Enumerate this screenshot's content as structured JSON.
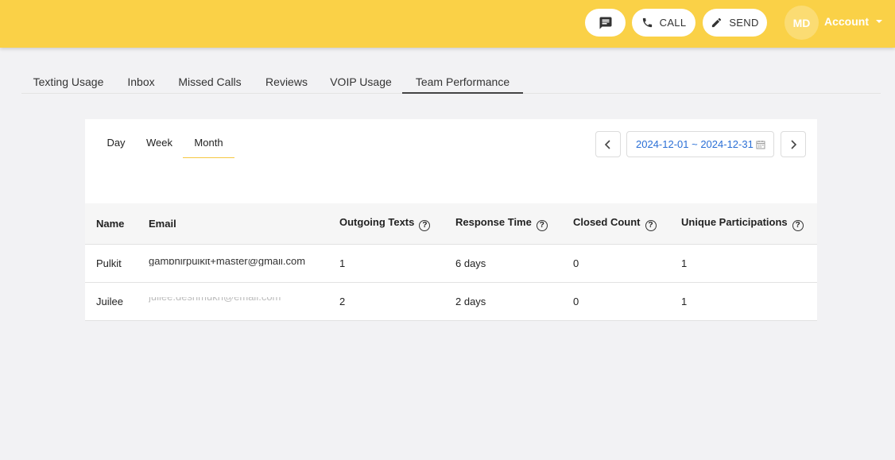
{
  "header": {
    "message_icon": "message-icon",
    "call_label": "CALL",
    "send_label": "SEND",
    "avatar_initials": "MD",
    "account_label": "Account"
  },
  "tabs": [
    {
      "label": "Texting Usage",
      "active": false
    },
    {
      "label": "Inbox",
      "active": false
    },
    {
      "label": "Missed Calls",
      "active": false
    },
    {
      "label": "Reviews",
      "active": false
    },
    {
      "label": "VOIP Usage",
      "active": false
    },
    {
      "label": "Team Performance",
      "active": true
    }
  ],
  "periods": [
    {
      "label": "Day",
      "active": false
    },
    {
      "label": "Week",
      "active": false
    },
    {
      "label": "Month",
      "active": true
    }
  ],
  "date_range": "2024-12-01 ~ 2024-12-31",
  "table": {
    "columns": [
      "Name",
      "Email",
      "Outgoing Texts",
      "Response Time",
      "Closed Count",
      "Unique Participations"
    ],
    "help_icon": "?",
    "rows": [
      {
        "name": "Pulkit",
        "email": "gambhirpulkit+master@gmail.com",
        "outgoing": "1",
        "response": "6 days",
        "closed": "0",
        "unique": "1"
      },
      {
        "name": "Juilee",
        "email": "juilee.deshmukh@email.com",
        "outgoing": "2",
        "response": "2 days",
        "closed": "0",
        "unique": "1"
      }
    ]
  },
  "colors": {
    "brand_yellow": "#fad147",
    "date_text": "#2a6fd6"
  }
}
